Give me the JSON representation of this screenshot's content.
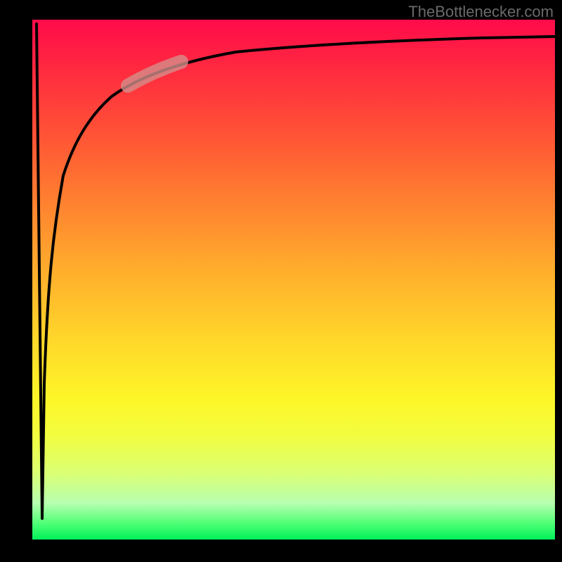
{
  "watermark": "TheBottlenecker.com",
  "chart_data": {
    "type": "line",
    "title": "",
    "xlabel": "",
    "ylabel": "",
    "xlim": [
      0,
      100
    ],
    "ylim": [
      0,
      100
    ],
    "series": [
      {
        "name": "bottleneck-curve",
        "x": [
          2.0,
          2.3,
          2.7,
          3.1,
          3.6,
          4.2,
          5.0,
          6.0,
          7.2,
          8.6,
          10.3,
          12.5,
          15.0,
          18.0,
          22.0,
          27.0,
          34.0,
          43.0,
          55.0,
          70.0,
          85.0,
          100.0
        ],
        "y": [
          4.0,
          30.0,
          50.0,
          62.0,
          70.0,
          76.0,
          80.5,
          84.0,
          86.6,
          88.6,
          90.2,
          91.5,
          92.5,
          93.3,
          94.0,
          94.6,
          95.2,
          95.7,
          96.2,
          96.6,
          96.9,
          97.1
        ]
      }
    ],
    "highlight": {
      "x_range": [
        18,
        28
      ],
      "color": "#d48f8c",
      "opacity": 0.78
    },
    "gradient_stops": [
      {
        "pos": 0.0,
        "color": "#ff0b4a"
      },
      {
        "pos": 0.5,
        "color": "#ffb32c"
      },
      {
        "pos": 0.8,
        "color": "#f2fd3f"
      },
      {
        "pos": 1.0,
        "color": "#00f05a"
      }
    ]
  }
}
